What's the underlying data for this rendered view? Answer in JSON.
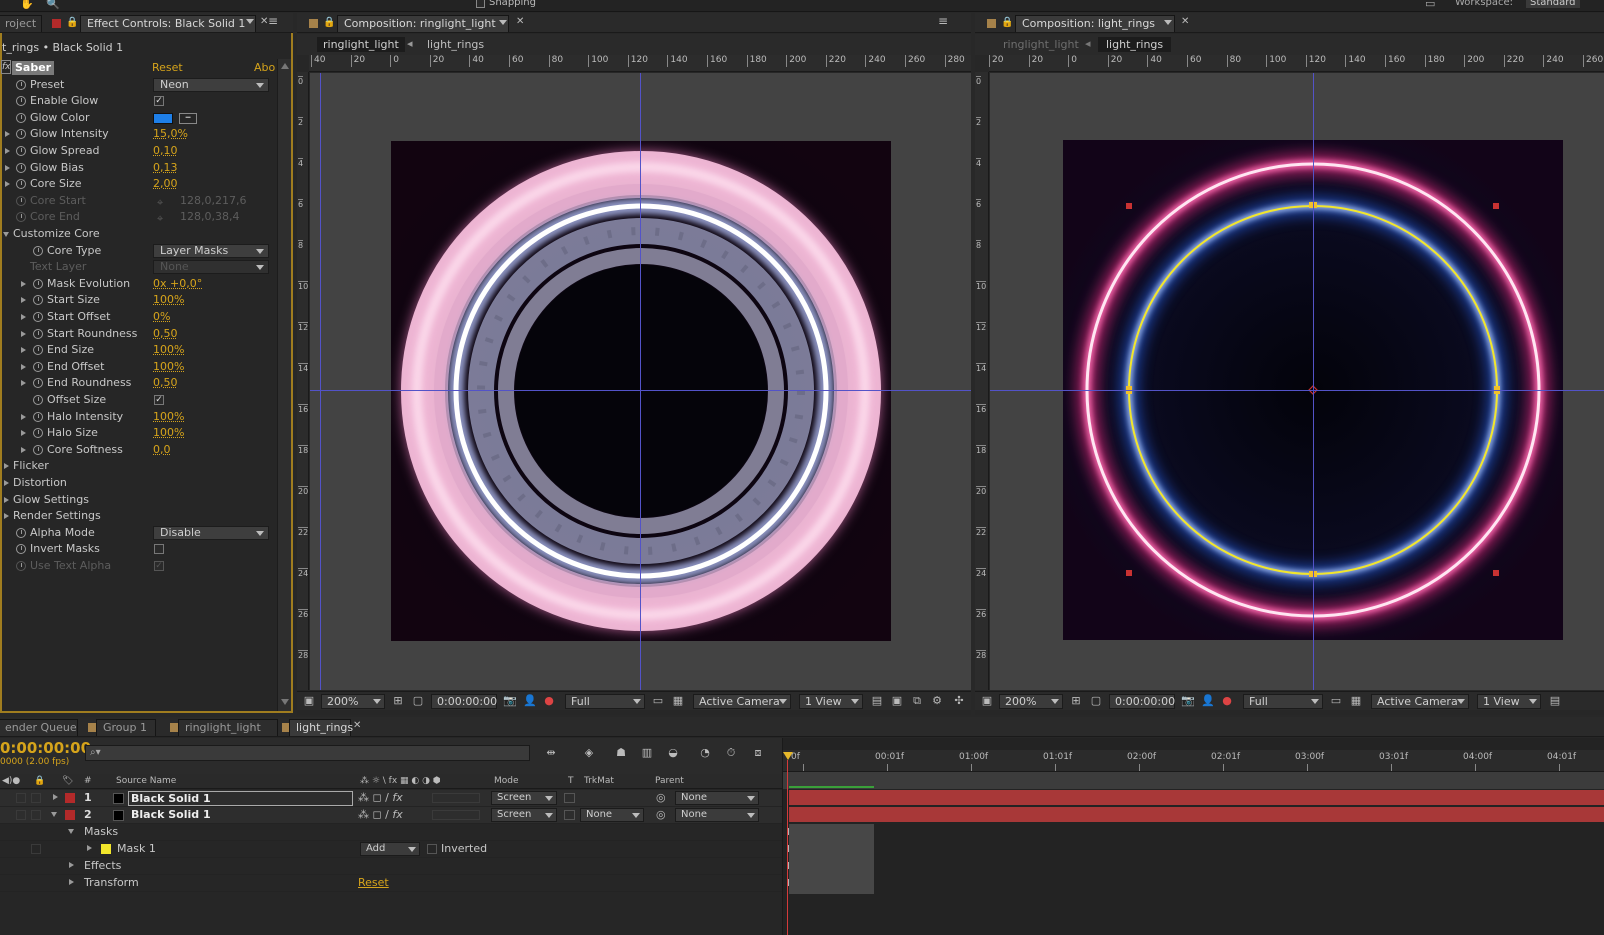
{
  "top_menu": {
    "snapping": "Snapping",
    "workspace_label": "Workspace:",
    "workspace_value": "Standard"
  },
  "effect_panel": {
    "tab_project": "roject",
    "tab_title": "Effect Controls: Black Solid 1",
    "breadcrumb": "t_rings • Black Solid 1",
    "effect_name": "Saber",
    "reset_label": "Reset",
    "about_label": "Abo",
    "fx_label": "fx",
    "rows": {
      "preset": {
        "label": "Preset",
        "value": "Neon"
      },
      "enable_glow": {
        "label": "Enable Glow",
        "checked": "✓"
      },
      "glow_color": {
        "label": "Glow Color",
        "color": "#1e7fe8"
      },
      "glow_intensity": {
        "label": "Glow Intensity",
        "value": "15,0%"
      },
      "glow_spread": {
        "label": "Glow Spread",
        "value": "0,10"
      },
      "glow_bias": {
        "label": "Glow Bias",
        "value": "0,13"
      },
      "core_size": {
        "label": "Core Size",
        "value": "2,00"
      },
      "core_start": {
        "label": "Core Start",
        "value": "128,0,217,6"
      },
      "core_end": {
        "label": "Core End",
        "value": "128,0,38,4"
      },
      "customize_core": {
        "label": "Customize Core"
      },
      "core_type": {
        "label": "Core Type",
        "value": "Layer Masks"
      },
      "text_layer": {
        "label": "Text Layer",
        "value": "None"
      },
      "mask_evolution": {
        "label": "Mask Evolution",
        "value": "0x +0,0°"
      },
      "start_size": {
        "label": "Start Size",
        "value": "100%"
      },
      "start_offset": {
        "label": "Start Offset",
        "value": "0%"
      },
      "start_roundness": {
        "label": "Start Roundness",
        "value": "0,50"
      },
      "end_size": {
        "label": "End Size",
        "value": "100%"
      },
      "end_offset": {
        "label": "End Offset",
        "value": "100%"
      },
      "end_roundness": {
        "label": "End Roundness",
        "value": "0,50"
      },
      "offset_size": {
        "label": "Offset Size",
        "checked": "✓"
      },
      "halo_intensity": {
        "label": "Halo Intensity",
        "value": "100%"
      },
      "halo_size": {
        "label": "Halo Size",
        "value": "100%"
      },
      "core_softness": {
        "label": "Core Softness",
        "value": "0,0"
      },
      "flicker": {
        "label": "Flicker"
      },
      "distortion": {
        "label": "Distortion"
      },
      "glow_settings": {
        "label": "Glow Settings"
      },
      "render_settings": {
        "label": "Render Settings"
      },
      "alpha_mode": {
        "label": "Alpha Mode",
        "value": "Disable"
      },
      "invert_masks": {
        "label": "Invert Masks",
        "checked": ""
      },
      "use_text_alpha": {
        "label": "Use Text Alpha",
        "checked": "✓"
      }
    }
  },
  "comp1": {
    "tab_title": "Composition: ringlight_light",
    "flow_active": "ringlight_light",
    "flow_other": "light_rings",
    "zoom": "200%",
    "timecode": "0:00:00:00",
    "resolution": "Full",
    "camera": "Active Camera",
    "view": "1 View",
    "ruler_h": [
      "40",
      "20",
      "0",
      "20",
      "40",
      "60",
      "80",
      "100",
      "120",
      "140",
      "160",
      "180",
      "200",
      "220",
      "240",
      "260",
      "280"
    ],
    "ruler_v": [
      "0",
      "2",
      "4",
      "6",
      "8",
      "10",
      "12",
      "14",
      "16",
      "18",
      "20",
      "22",
      "24",
      "26",
      "28"
    ]
  },
  "comp2": {
    "tab_title": "Composition: light_rings",
    "flow_other": "ringlight_light",
    "flow_active": "light_rings",
    "zoom": "200%",
    "timecode": "0:00:00:00",
    "resolution": "Full",
    "camera": "Active Camera",
    "view": "1 View",
    "ruler_h": [
      "20",
      "20",
      "0",
      "20",
      "40",
      "60",
      "80",
      "100",
      "120",
      "140",
      "160",
      "180",
      "200",
      "220",
      "240",
      "260",
      "280"
    ]
  },
  "timeline": {
    "tabs": [
      "ender Queue",
      "Group 1",
      "ringlight_light",
      "light_rings"
    ],
    "timecode": "0:00:00:00",
    "fps": "0000 (2.00 fps)",
    "search_placeholder": "",
    "headers": {
      "num": "#",
      "source": "Source Name",
      "mode": "Mode",
      "t": "T",
      "trkmat": "TrkMat",
      "parent": "Parent"
    },
    "ruler": [
      "0f",
      "00:01f",
      "01:00f",
      "01:01f",
      "02:00f",
      "02:01f",
      "03:00f",
      "03:01f",
      "04:00f",
      "04:01f"
    ],
    "layers": [
      {
        "num": "1",
        "name": "Black Solid 1",
        "mode": "Screen",
        "trkmat": "",
        "parent": "None"
      },
      {
        "num": "2",
        "name": "Black Solid 1",
        "mode": "Screen",
        "trkmat": "None",
        "parent": "None"
      }
    ],
    "masks_label": "Masks",
    "mask1": {
      "name": "Mask 1",
      "mode": "Add",
      "inverted": "Inverted"
    },
    "effects_label": "Effects",
    "transform_label": "Transform",
    "transform_reset": "Reset"
  }
}
